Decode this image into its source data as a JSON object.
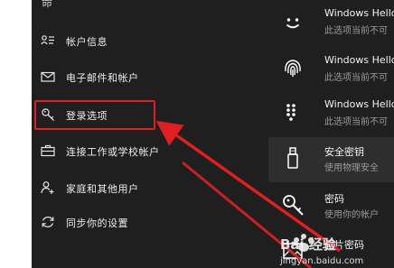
{
  "sidebar": {
    "top_glyph": "命",
    "items": [
      {
        "label": "帐户信息",
        "icon": "person-card-icon"
      },
      {
        "label": "电子邮件和帐户",
        "icon": "mail-icon"
      },
      {
        "label": "登录选项",
        "icon": "key-icon"
      },
      {
        "label": "连接工作或学校帐户",
        "icon": "briefcase-icon"
      },
      {
        "label": "家庭和其他用户",
        "icon": "person-add-icon"
      },
      {
        "label": "同步你的设置",
        "icon": "sync-icon"
      }
    ]
  },
  "options": [
    {
      "title": "Windows Hello",
      "subtitle": "此选项当前不可",
      "icon": "smiley-face-icon"
    },
    {
      "title": "Windows Hello",
      "subtitle": "此选项当前不可",
      "icon": "fingerprint-icon"
    },
    {
      "title": "Windows Hello",
      "subtitle": "此选项当前不可",
      "icon": "pin-keypad-icon"
    },
    {
      "title": "安全密钥",
      "subtitle": "使用物理安全",
      "icon": "usb-key-icon"
    },
    {
      "title": "密码",
      "subtitle": "使用你的帐户",
      "icon": "password-key-icon"
    },
    {
      "title": "图片密码",
      "subtitle": "",
      "icon": "picture-icon"
    }
  ],
  "watermark": {
    "text": "Bai 经验",
    "url": "jingyan.baidu.com"
  },
  "colors": {
    "annotation_red": "#e02020",
    "background": "#1f1f1f",
    "selected_row": "#2e2e2e"
  }
}
